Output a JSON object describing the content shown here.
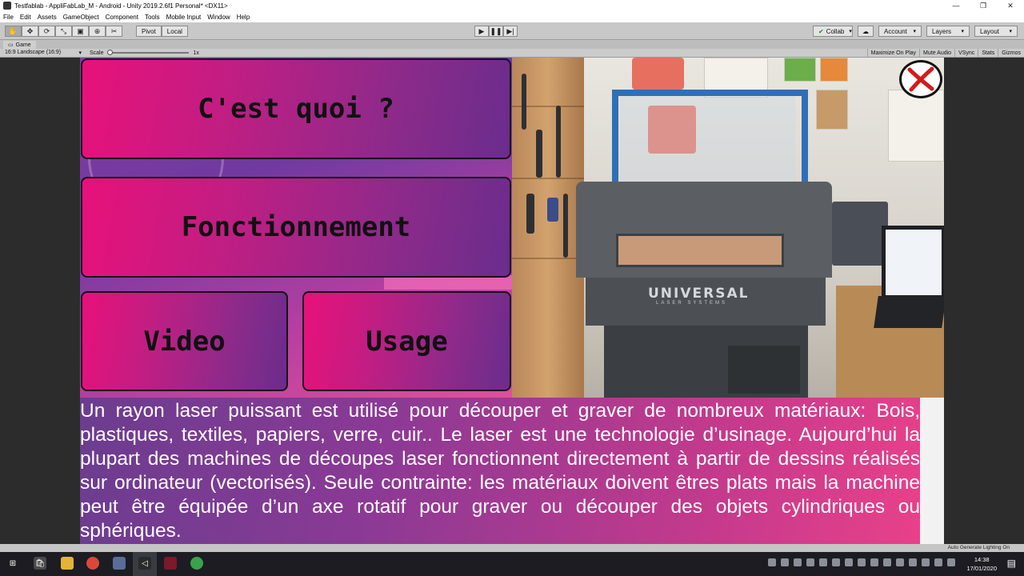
{
  "window": {
    "title": "Testfablab - AppliFabLab_M - Android - Unity 2019.2.6f1 Personal* <DX11>",
    "controls": [
      "—",
      "❐",
      "✕"
    ]
  },
  "menu": [
    "File",
    "Edit",
    "Assets",
    "GameObject",
    "Component",
    "Tools",
    "Mobile Input",
    "Window",
    "Help"
  ],
  "toolbar": {
    "pivot": "Pivot",
    "local": "Local",
    "collab": "Collab",
    "account": "Account",
    "layers": "Layers",
    "layout": "Layout"
  },
  "game_tab": {
    "label": "Game"
  },
  "game_bar": {
    "aspect": "16:9 Landscape (16:9)",
    "scale_label": "Scale",
    "scale_value": "1x",
    "options": [
      "Maximize On Play",
      "Mute Audio",
      "VSync",
      "Stats",
      "Gizmos"
    ]
  },
  "app": {
    "buttons": {
      "quoi": "C'est quoi ?",
      "fonctionnement": "Fonctionnement",
      "video": "Video",
      "usage": "Usage"
    },
    "machine_brand": "UNIVERSAL",
    "machine_sub": "LASER SYSTEMS",
    "description": "Un rayon laser puissant est utilisé pour découper et graver de nombreux matériaux: Bois, plastiques, textiles, papiers, verre, cuir.. Le laser est une technologie d’usinage. Aujourd’hui la plupart des machines de découpes laser fonctionnent directement à partir de dessins réalisés sur ordinateur (vectorisés). Seule contrainte: les matériaux doivent êtres plats mais la machine peut être équipée d’un axe rotatif pour graver ou découper des objets cylindriques ou sphériques."
  },
  "status": {
    "right": "Auto Generate Lighting On"
  },
  "taskbar": {
    "time": "14:38",
    "date": "17/01/2020"
  },
  "colors": {
    "button_start": "#e8117a",
    "button_end": "#6a2d8c",
    "close_x": "#d41a1a",
    "lid": "#2f6fb5"
  }
}
